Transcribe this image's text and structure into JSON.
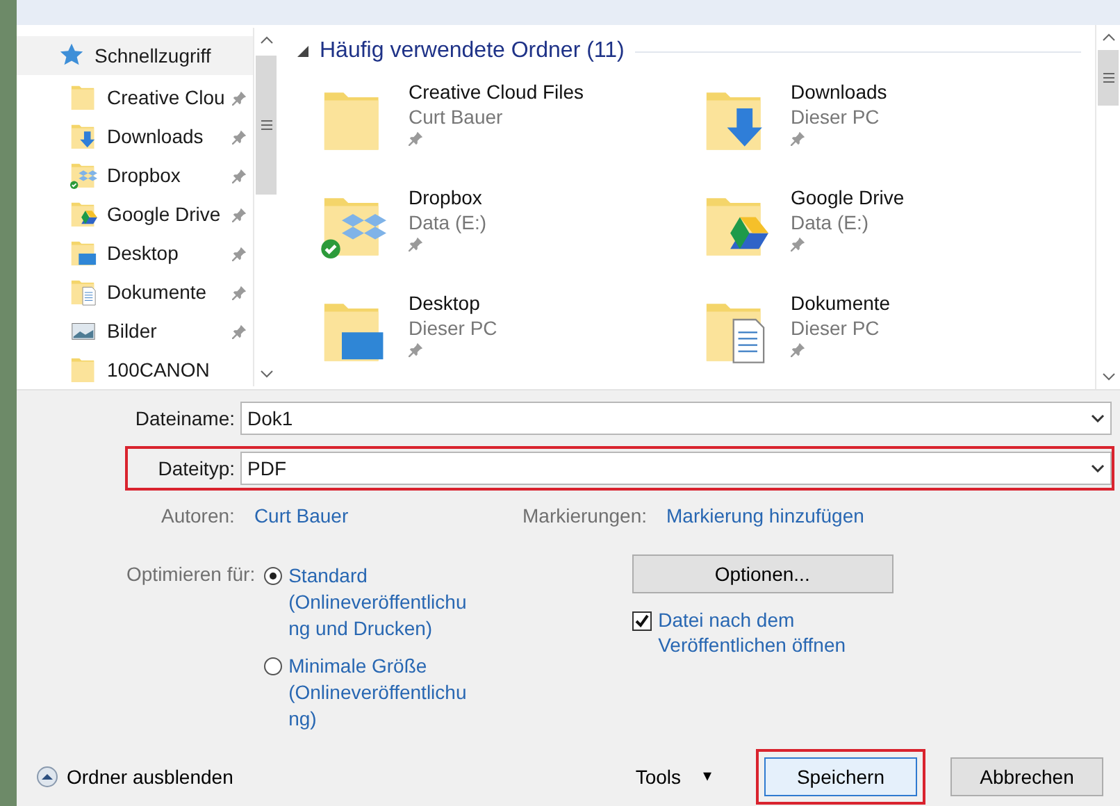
{
  "navigation": {
    "header": {
      "label": "Schnellzugriff",
      "kind": "star"
    },
    "items": [
      {
        "label": "Creative Clou",
        "kind": "folder",
        "pinned": true
      },
      {
        "label": "Downloads",
        "kind": "download",
        "pinned": true
      },
      {
        "label": "Dropbox",
        "kind": "dropbox",
        "pinned": true
      },
      {
        "label": "Google Drive",
        "kind": "gdrive",
        "pinned": true
      },
      {
        "label": "Desktop",
        "kind": "desktop",
        "pinned": true
      },
      {
        "label": "Dokumente",
        "kind": "document",
        "pinned": true
      },
      {
        "label": "Bilder",
        "kind": "pictures",
        "pinned": true
      },
      {
        "label": "100CANON",
        "kind": "folder",
        "pinned": false
      }
    ]
  },
  "section": {
    "title": "Häufig verwendete Ordner (11)",
    "expanded": true
  },
  "folders": [
    {
      "name": "Creative Cloud Files",
      "location": "Curt Bauer",
      "kind": "folder",
      "pinned": true
    },
    {
      "name": "Downloads",
      "location": "Dieser PC",
      "kind": "download",
      "pinned": true
    },
    {
      "name": "Dropbox",
      "location": "Data (E:)",
      "kind": "dropbox",
      "pinned": true
    },
    {
      "name": "Google Drive",
      "location": "Data (E:)",
      "kind": "gdrive",
      "pinned": true
    },
    {
      "name": "Desktop",
      "location": "Dieser PC",
      "kind": "desktop",
      "pinned": true
    },
    {
      "name": "Dokumente",
      "location": "Dieser PC",
      "kind": "document",
      "pinned": true
    }
  ],
  "fields": [
    {
      "label": "Dateiname:",
      "value": "Dok1",
      "highlighted": false
    },
    {
      "label": "Dateityp:",
      "value": "PDF",
      "highlighted": true
    }
  ],
  "metadata": [
    {
      "label": "Autoren:",
      "value": "Curt Bauer"
    },
    {
      "label": "Markierungen:",
      "value": "Markierung hinzufügen"
    }
  ],
  "optimize": {
    "label": "Optimieren für:",
    "options": [
      {
        "label": "Standard",
        "description": "(Onlineveröffentlichung und Drucken)",
        "selected": true
      },
      {
        "label": "Minimale Größe",
        "description": "(Onlineveröffentlichung)",
        "selected": false
      }
    ]
  },
  "options_button": "Optionen...",
  "open_after": {
    "label": "Datei nach dem Veröffentlichen öffnen",
    "checked": true
  },
  "footer": {
    "hide_folders": "Ordner ausblenden",
    "tools": "Tools",
    "tools_caret": "▾",
    "buttons": [
      {
        "label": "Speichern",
        "kind": "primary",
        "highlighted": true
      },
      {
        "label": "Abbrechen",
        "kind": "secondary",
        "highlighted": false
      }
    ]
  }
}
